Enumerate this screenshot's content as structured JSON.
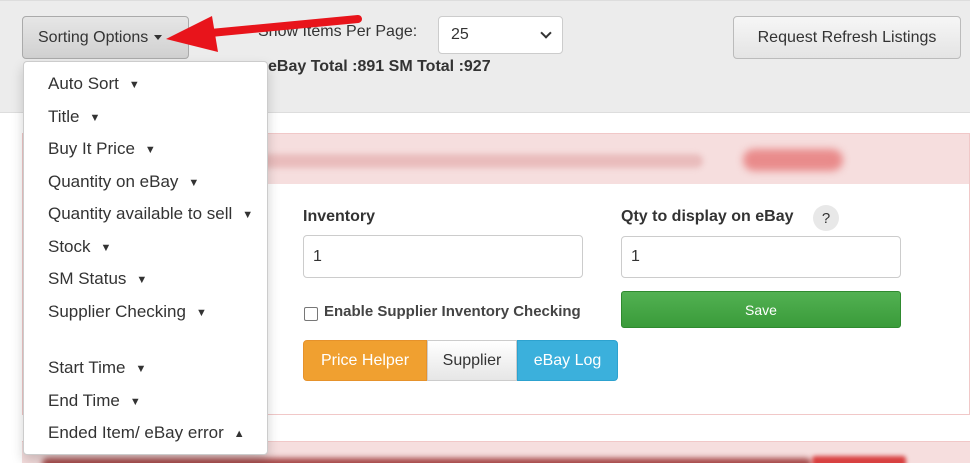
{
  "toolbar": {
    "sort_label": "Sorting Options",
    "per_page_label": "Show Items Per Page:",
    "per_page_value": "25",
    "totals": "eBay Total :891 SM Total :927",
    "refresh_label": "Request Refresh Listings"
  },
  "sort_menu": {
    "items": [
      {
        "label": "Auto Sort",
        "arrow": "▼"
      },
      {
        "label": "Title",
        "arrow": "▼"
      },
      {
        "label": "Buy It Price",
        "arrow": "▼"
      },
      {
        "label": "Quantity on eBay",
        "arrow": "▼"
      },
      {
        "label": "Quantity available to sell",
        "arrow": "▼"
      },
      {
        "label": "Stock",
        "arrow": "▼"
      },
      {
        "label": "SM Status",
        "arrow": "▼"
      },
      {
        "label": "Supplier Checking",
        "arrow": "▼"
      },
      {
        "label": "Start Time",
        "arrow": "▼"
      },
      {
        "label": "End Time",
        "arrow": "▼"
      },
      {
        "label": "Ended Item/ eBay error",
        "arrow": "▲"
      }
    ]
  },
  "listing": {
    "inventory_label": "Inventory",
    "inventory_value": "1",
    "qty_label": "Qty to display on eBay",
    "help_glyph": "?",
    "qty_value": "1",
    "checkbox_label": "Enable Supplier Inventory Checking",
    "save_label": "Save",
    "price_helper_label": "Price Helper",
    "supplier_label": "Supplier",
    "ebay_log_label": "eBay Log"
  },
  "colors": {
    "annotation_arrow": "#e8141b",
    "save_green": "#46a846",
    "price_orange": "#f0a030",
    "ebay_blue": "#3bb0dc",
    "header_pink": "#f6dede"
  }
}
